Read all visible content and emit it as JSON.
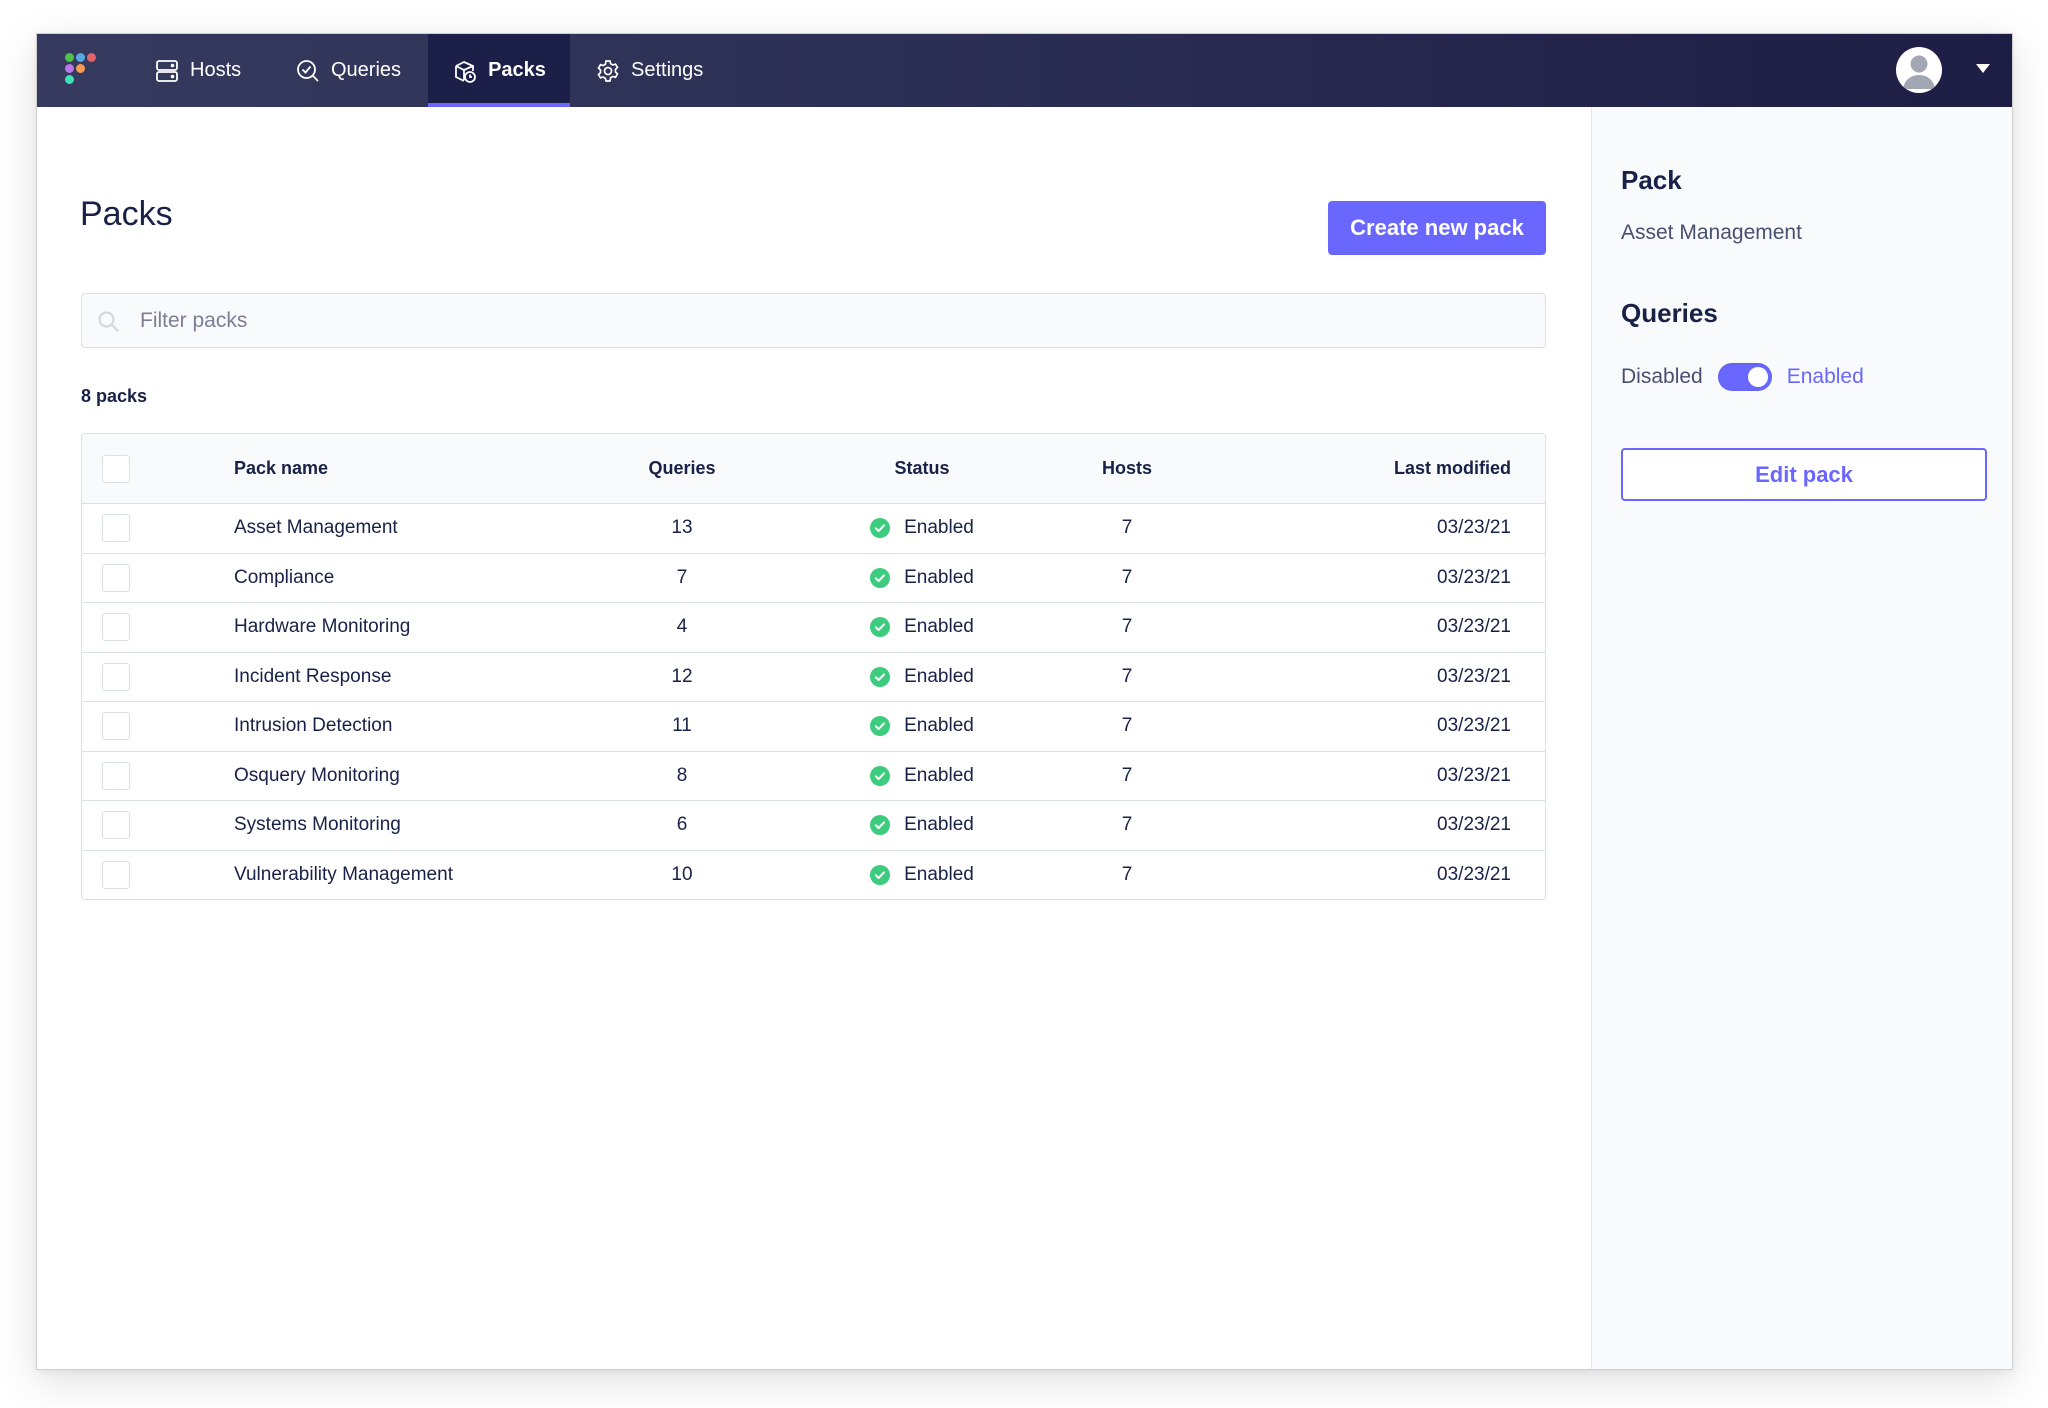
{
  "nav": {
    "logo_colors": [
      "#4fc24c",
      "#55a8e2",
      "#e3636c",
      "#b877e8",
      "#f89b55",
      "#3ee0b6"
    ],
    "items": [
      {
        "label": "Hosts",
        "icon": "hosts-icon",
        "active": false
      },
      {
        "label": "Queries",
        "icon": "queries-icon",
        "active": false
      },
      {
        "label": "Packs",
        "icon": "packs-icon",
        "active": true
      },
      {
        "label": "Settings",
        "icon": "settings-icon",
        "active": false
      }
    ],
    "accent": "#6a67fe"
  },
  "main": {
    "title": "Packs",
    "create_button": "Create new pack",
    "filter_placeholder": "Filter packs",
    "filter_value": "",
    "count_label": "8 packs",
    "table": {
      "columns": [
        "Pack name",
        "Queries",
        "Status",
        "Hosts",
        "Last modified"
      ],
      "rows": [
        {
          "name": "Asset Management",
          "queries": "13",
          "status": "Enabled",
          "hosts": "7",
          "modified": "03/23/21"
        },
        {
          "name": "Compliance",
          "queries": "7",
          "status": "Enabled",
          "hosts": "7",
          "modified": "03/23/21"
        },
        {
          "name": "Hardware Monitoring",
          "queries": "4",
          "status": "Enabled",
          "hosts": "7",
          "modified": "03/23/21"
        },
        {
          "name": "Incident Response",
          "queries": "12",
          "status": "Enabled",
          "hosts": "7",
          "modified": "03/23/21"
        },
        {
          "name": "Intrusion Detection",
          "queries": "11",
          "status": "Enabled",
          "hosts": "7",
          "modified": "03/23/21"
        },
        {
          "name": "Osquery Monitoring",
          "queries": "8",
          "status": "Enabled",
          "hosts": "7",
          "modified": "03/23/21"
        },
        {
          "name": "Systems Monitoring",
          "queries": "6",
          "status": "Enabled",
          "hosts": "7",
          "modified": "03/23/21"
        },
        {
          "name": "Vulnerability Management",
          "queries": "10",
          "status": "Enabled",
          "hosts": "7",
          "modified": "03/23/21"
        }
      ]
    },
    "status_color": "#3dcc7d"
  },
  "sidebar": {
    "pack_heading": "Pack",
    "pack_name": "Asset Management",
    "queries_heading": "Queries",
    "toggle_off_label": "Disabled",
    "toggle_on_label": "Enabled",
    "toggle_enabled": true,
    "edit_button": "Edit pack"
  }
}
